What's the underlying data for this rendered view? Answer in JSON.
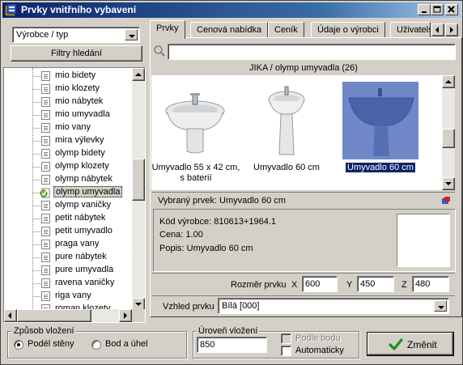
{
  "window": {
    "title": "Prvky vnitřního vybavení",
    "minimize_icon": "minimize-icon",
    "maximize_icon": "maximize-icon",
    "close_icon": "close-icon"
  },
  "left": {
    "filter_combo": "Výrobce / typ",
    "filter_button": "Filtry hledání",
    "tree_items": [
      "mio bidety",
      "mio klozety",
      "mio nábytek",
      "mio umyvadla",
      "mio vany",
      "mira výlevky",
      "olymp bidety",
      "olymp klozety",
      "olymp nábytek",
      "olymp umyvadla",
      "olymp vaničky",
      "petit nábytek",
      "petit umyvadlo",
      "praga vany",
      "pure nábytek",
      "pure umyvadla",
      "ravena vaničky",
      "riga vany",
      "roman klozety"
    ],
    "selected_index": 9
  },
  "tabs": [
    "Prvky",
    "Cenová nabídka",
    "Ceník",
    "Údaje o výrobci",
    "Uživatels"
  ],
  "active_tab": 0,
  "search": {
    "value": "",
    "icon": "search-icon"
  },
  "gallery": {
    "header": "JIKA / olymp umyvadla (26)",
    "products": [
      {
        "caption_line1": "Umyvadlo 55 x 42 cm,",
        "caption_line2": "s baterií"
      },
      {
        "caption_line1": "Umyvadlo 60 cm",
        "caption_line2": ""
      },
      {
        "caption_line1": "Umyvadlo 60 cm",
        "caption_line2": ""
      }
    ],
    "selected_index": 2
  },
  "selected": {
    "label": "Vybraný prvek: Umyvadlo 60 cm",
    "code": "Kód výrobce: 810613+1964.1",
    "price": "Cena: 1.00",
    "description": "Popis: Umyvadlo 60 cm"
  },
  "dimensions": {
    "label": "Rozměr prvku",
    "x_label": "X",
    "x_value": "600",
    "y_label": "Y",
    "y_value": "450",
    "z_label": "Z",
    "z_value": "480"
  },
  "appearance": {
    "label": "Vzhled prvku",
    "value": "Bílá [000]"
  },
  "insert_mode": {
    "title": "Způsob vložení",
    "option_wall": "Podél stěny",
    "option_point": "Bod a úhel",
    "selected": "wall"
  },
  "insert_level": {
    "title": "Úroveň vložení",
    "value": "850",
    "by_point_label": "Podle bodu",
    "auto_label": "Automaticky",
    "by_point_checked": false,
    "auto_checked": false
  },
  "change_button": {
    "label": "Změnit",
    "icon": "checkmark-icon",
    "icon_color": "#1e8c1e"
  }
}
